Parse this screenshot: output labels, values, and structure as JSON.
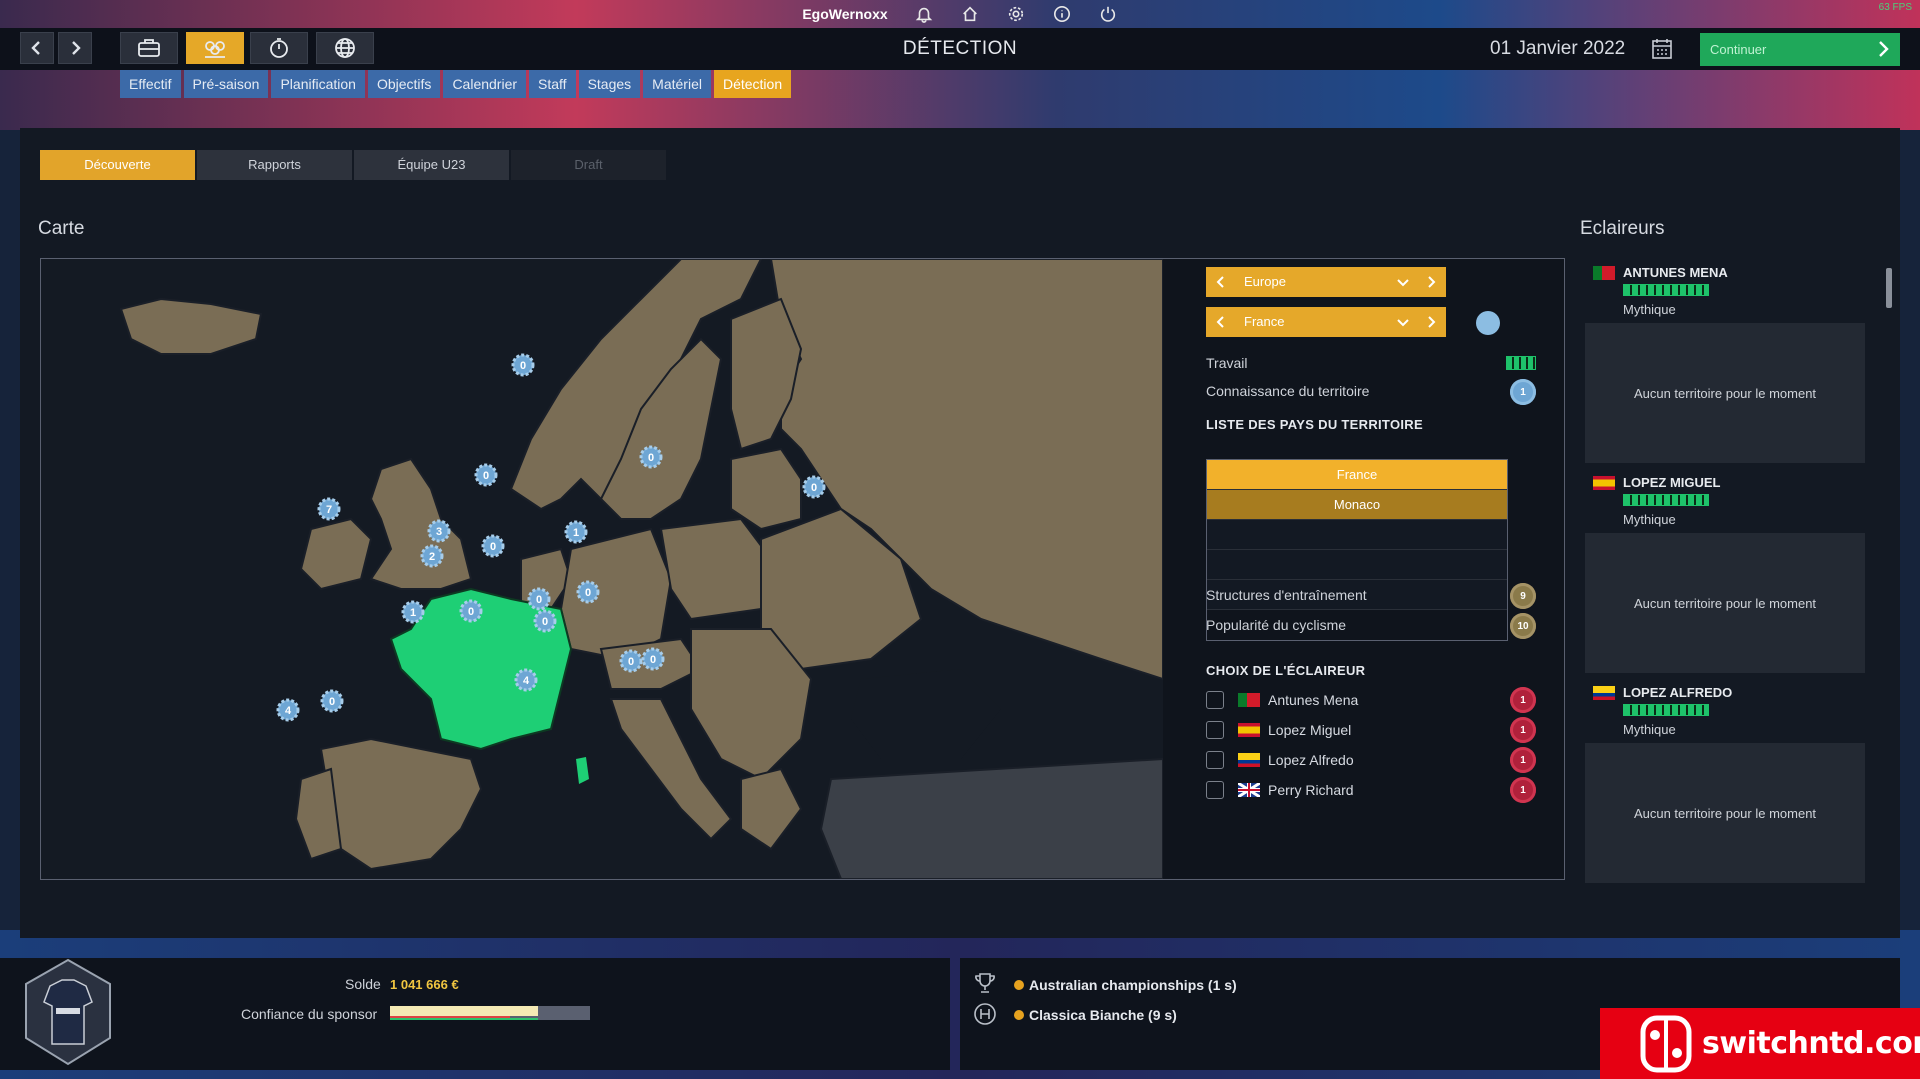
{
  "topbar": {
    "username": "EgoWernoxx",
    "icons": [
      "bell-icon",
      "home-icon",
      "settings-icon",
      "info-icon",
      "power-icon"
    ],
    "fps": "63 FPS"
  },
  "header": {
    "title": "DÉTECTION",
    "date": "01 Janvier 2022",
    "continue_label": "Continuer",
    "mode_icons": [
      "briefcase-icon",
      "team-icon",
      "stopwatch-icon",
      "globe-icon"
    ],
    "active_mode": 1
  },
  "subtabs": {
    "items": [
      "Effectif",
      "Pré-saison",
      "Planification",
      "Objectifs",
      "Calendrier",
      "Staff",
      "Stages",
      "Matériel",
      "Détection"
    ],
    "active": 8
  },
  "segments": {
    "items": [
      "Découverte",
      "Rapports",
      "Équipe U23",
      "Draft"
    ],
    "active": 0,
    "disabled": [
      3
    ]
  },
  "map_section": {
    "title": "Carte",
    "markers": [
      "0",
      "0",
      "0",
      "0",
      "7",
      "3",
      "0",
      "1",
      "2",
      "1",
      "0",
      "0",
      "0",
      "0",
      "0",
      "4",
      "0",
      "4",
      "0"
    ]
  },
  "territory": {
    "region": "Europe",
    "country": "France",
    "travail_label": "Travail",
    "connaissance_label": "Connaissance du territoire",
    "connaissance_value": "1",
    "list_title": "LISTE DES PAYS DU TERRITOIRE",
    "countries": [
      "France",
      "Monaco"
    ],
    "structures_label": "Structures d'entraînement",
    "structures_value": "9",
    "popularite_label": "Popularité du cyclisme",
    "popularite_value": "10",
    "scout_choice_title": "CHOIX DE L'ÉCLAIREUR",
    "scout_choices": [
      {
        "name": "Antunes Mena",
        "flag": "portugal",
        "value": "1"
      },
      {
        "name": "Lopez Miguel",
        "flag": "spain",
        "value": "1"
      },
      {
        "name": "Lopez Alfredo",
        "flag": "colombia",
        "value": "1"
      },
      {
        "name": "Perry Richard",
        "flag": "uk",
        "value": "1"
      }
    ]
  },
  "scouts": {
    "title": "Eclaireurs",
    "cards": [
      {
        "name": "ANTUNES MENA",
        "level": "Mythique",
        "flag": "portugal",
        "status": "Aucun territoire pour le moment"
      },
      {
        "name": "LOPEZ MIGUEL",
        "level": "Mythique",
        "flag": "spain",
        "status": "Aucun territoire pour le moment"
      },
      {
        "name": "LOPEZ ALFREDO",
        "level": "Mythique",
        "flag": "colombia",
        "status": "Aucun territoire pour le moment"
      }
    ]
  },
  "bottom": {
    "solde_label": "Solde",
    "solde_value": "1 041 666 €",
    "sponsor_label": "Confiance du sponsor",
    "sponsor_confidence": 0.74,
    "races": [
      {
        "name": "Australian championships (1 s)",
        "icon": "trophy-icon"
      },
      {
        "name": "Classica Bianche (9 s)",
        "icon": "race-icon"
      }
    ]
  },
  "watermark": {
    "text": "switchntd.com"
  },
  "colors": {
    "accent": "#e5a828",
    "selected_country": "#1ecf75",
    "land": "#7a6d55",
    "marker": "#6ea6d4",
    "continue": "#1fa85a"
  }
}
